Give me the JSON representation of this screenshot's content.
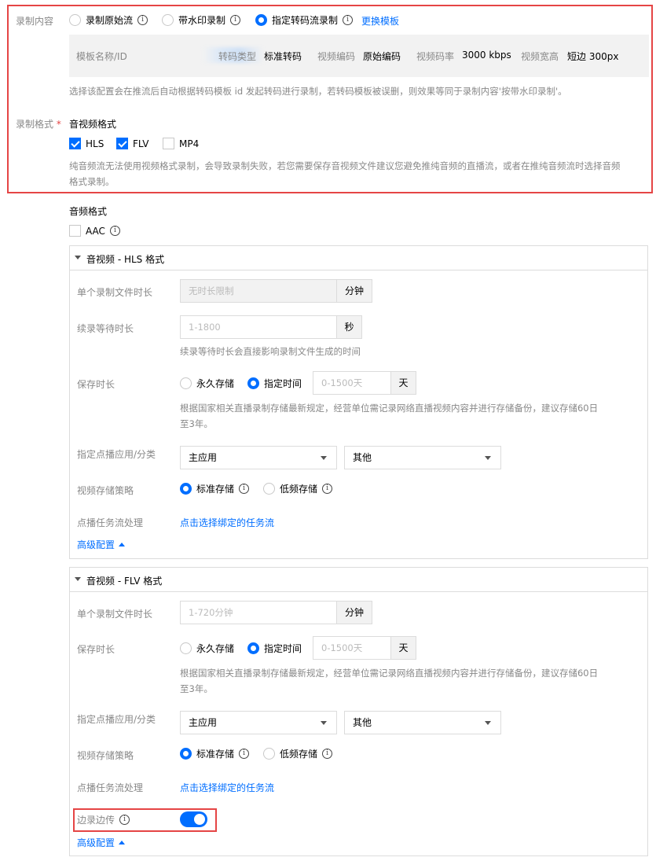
{
  "record_content": {
    "label": "录制内容",
    "options": [
      "录制原始流",
      "带水印录制",
      "指定转码流录制"
    ],
    "selected_index": 2,
    "change_template_link": "更换模板",
    "template": {
      "name_label": "模板名称/ID",
      "type_label": "转码类型",
      "type_value": "标准转码",
      "video_codec_label": "视频编码",
      "video_codec_value": "原始编码",
      "bitrate_label": "视频码率",
      "bitrate_value": "3000 kbps",
      "size_label": "视频宽高",
      "size_value": "短边 300px"
    },
    "hint": "选择该配置会在推流后自动根据转码模板 id 发起转码进行录制，若转码模板被误删，则效果等同于录制内容'按带水印录制'。"
  },
  "record_format": {
    "label": "录制格式",
    "required_mark": "*",
    "av_format_title": "音视频格式",
    "av_options": [
      {
        "label": "HLS",
        "checked": true
      },
      {
        "label": "FLV",
        "checked": true
      },
      {
        "label": "MP4",
        "checked": false
      }
    ],
    "av_hint_line1": "纯音频流无法使用视频格式录制，会导致录制失败，若您需要保存音视频文件建议您避免推纯音频的直播流，或者在推纯音频流时选择音频",
    "av_hint_line2": "格式录制。",
    "audio_format_title": "音频格式",
    "audio_options": [
      {
        "label": "AAC",
        "checked": false
      }
    ]
  },
  "hls_panel": {
    "title": "音视频 - HLS 格式",
    "file_duration_label": "单个录制文件时长",
    "file_duration_placeholder": "无时长限制",
    "file_duration_unit": "分钟",
    "resume_wait_label": "续录等待时长",
    "resume_wait_placeholder": "1-1800",
    "resume_wait_unit": "秒",
    "resume_wait_hint": "续录等待时长会直接影响录制文件生成的时间",
    "storage_label": "保存时长",
    "storage_options": [
      "永久存储",
      "指定时间"
    ],
    "storage_selected": 1,
    "storage_placeholder": "0-1500天",
    "storage_unit": "天",
    "storage_hint_line1": "根据国家相关直播录制存储最新规定，经营单位需记录网络直播视频内容并进行存储备份，建议存储60日",
    "storage_hint_line2": "至3年。",
    "vod_app_label": "指定点播应用/分类",
    "vod_app_value": "主应用",
    "vod_category_value": "其他",
    "policy_label": "视频存储策略",
    "policy_options": [
      "标准存储",
      "低频存储"
    ],
    "policy_selected": 0,
    "task_label": "点播任务流处理",
    "task_link": "点击选择绑定的任务流",
    "advanced_label": "高级配置"
  },
  "flv_panel": {
    "title": "音视频 - FLV 格式",
    "file_duration_label": "单个录制文件时长",
    "file_duration_placeholder": "1-720分钟",
    "file_duration_unit": "分钟",
    "storage_label": "保存时长",
    "storage_options": [
      "永久存储",
      "指定时间"
    ],
    "storage_selected": 1,
    "storage_placeholder": "0-1500天",
    "storage_unit": "天",
    "storage_hint_line1": "根据国家相关直播录制存储最新规定，经营单位需记录网络直播视频内容并进行存储备份，建议存储60日",
    "storage_hint_line2": "至3年。",
    "vod_app_label": "指定点播应用/分类",
    "vod_app_value": "主应用",
    "vod_category_value": "其他",
    "policy_label": "视频存储策略",
    "policy_options": [
      "标准存储",
      "低频存储"
    ],
    "policy_selected": 0,
    "task_label": "点播任务流处理",
    "task_link": "点击选择绑定的任务流",
    "upload_while_recording_label": "边录边传",
    "upload_while_recording_on": true,
    "advanced_label": "高级配置"
  },
  "colors": {
    "accent": "#006eff",
    "highlight_frame": "#e54545"
  }
}
